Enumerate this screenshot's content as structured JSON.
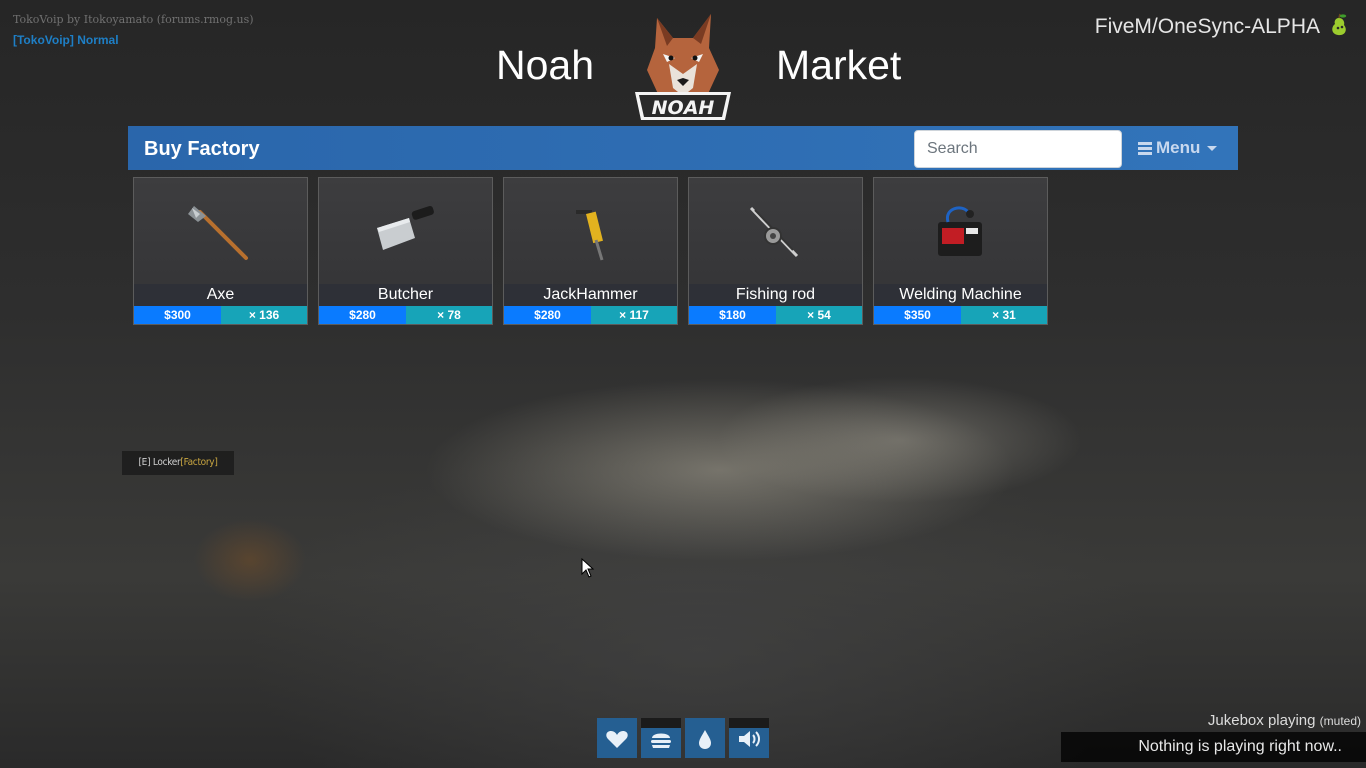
{
  "overlay": {
    "voip_credit": "TokoVoip by Itokoyamato (forums.rmog.us)",
    "voip_mode": "[TokoVoip] Normal",
    "server_name": "FiveM/OneSync-ALPHA",
    "server_icon": "pear-icon"
  },
  "header": {
    "left_text": "Noah",
    "right_text": "Market",
    "logo_text": "NOAH",
    "logo_icon": "wolf-logo"
  },
  "toolbar": {
    "title": "Buy Factory",
    "search_placeholder": "Search",
    "search_value": "",
    "menu_label": "Menu",
    "color": "#2a66ab"
  },
  "items": [
    {
      "name": "Axe",
      "price": "$300",
      "stock": "× 136",
      "icon": "axe-icon"
    },
    {
      "name": "Butcher",
      "price": "$280",
      "stock": "× 78",
      "icon": "cleaver-icon"
    },
    {
      "name": "JackHammer",
      "price": "$280",
      "stock": "× 117",
      "icon": "jackhammer-icon"
    },
    {
      "name": "Fishing rod",
      "price": "$180",
      "stock": "× 54",
      "icon": "fishing-rod-icon"
    },
    {
      "name": "Welding Machine",
      "price": "$350",
      "stock": "× 31",
      "icon": "welding-machine-icon"
    }
  ],
  "locker_hint": {
    "key": "[E]",
    "label": "Locker",
    "tag_open": "[",
    "tag_text": "Factory",
    "tag_close": "]"
  },
  "status": [
    {
      "name": "health",
      "icon": "heart-icon",
      "level": 1.0
    },
    {
      "name": "hunger",
      "icon": "burger-icon",
      "level": 0.75
    },
    {
      "name": "thirst",
      "icon": "water-drop-icon",
      "level": 1.0
    },
    {
      "name": "voice",
      "icon": "speaker-icon",
      "level": 0.75
    }
  ],
  "jukebox": {
    "label": "Jukebox playing",
    "muted": "(muted)",
    "now_playing": "Nothing is playing right now.."
  },
  "colors": {
    "price_badge": "#0a7bff",
    "stock_badge": "#17a4b8",
    "status_fill": "#255f92"
  }
}
